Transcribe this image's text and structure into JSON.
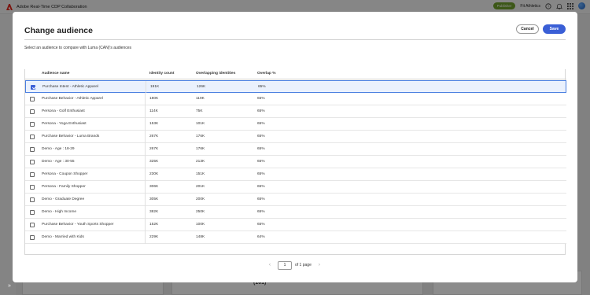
{
  "app": {
    "title": "Adobe Real-Time CDP Collaboration",
    "badge": "Publisher",
    "org": "Fit Athletics"
  },
  "background": {
    "count_label": "(101)"
  },
  "modal": {
    "title": "Change audience",
    "cancel_label": "Cancel",
    "save_label": "Save",
    "description": "Select an audience to compare with Luma (CAN)'s audiences"
  },
  "table": {
    "columns": [
      "Audience name",
      "Identity count",
      "Overlapping identities",
      "Overlap %"
    ],
    "rows": [
      {
        "name": "Purchase Intent - Athletic Apparel",
        "identity": "191K",
        "overlap": "126K",
        "pct": "65%",
        "checked": true
      },
      {
        "name": "Purchase Behavior - Athletic Apparel",
        "identity": "180K",
        "overlap": "119K",
        "pct": "65%",
        "checked": false
      },
      {
        "name": "Persona - Golf Enthusiast",
        "identity": "114K",
        "overlap": "75K",
        "pct": "65%",
        "checked": false
      },
      {
        "name": "Persona - Yoga Enthusiast",
        "identity": "153K",
        "overlap": "101K",
        "pct": "65%",
        "checked": false
      },
      {
        "name": "Purchase Behavior - Luma Brands",
        "identity": "267K",
        "overlap": "176K",
        "pct": "65%",
        "checked": false
      },
      {
        "name": "Demo - Age : 18-29",
        "identity": "267K",
        "overlap": "176K",
        "pct": "65%",
        "checked": false
      },
      {
        "name": "Demo - Age : 30-55",
        "identity": "325K",
        "overlap": "213K",
        "pct": "65%",
        "checked": false
      },
      {
        "name": "Persona - Coupon Shopper",
        "identity": "230K",
        "overlap": "151K",
        "pct": "65%",
        "checked": false
      },
      {
        "name": "Persona - Family Shopper",
        "identity": "306K",
        "overlap": "201K",
        "pct": "65%",
        "checked": false
      },
      {
        "name": "Demo - Graduate Degree",
        "identity": "305K",
        "overlap": "200K",
        "pct": "65%",
        "checked": false
      },
      {
        "name": "Demo - High Income",
        "identity": "382K",
        "overlap": "250K",
        "pct": "65%",
        "checked": false
      },
      {
        "name": "Purchase Behavior - Youth Sports Shopper",
        "identity": "152K",
        "overlap": "100K",
        "pct": "65%",
        "checked": false
      },
      {
        "name": "Demo - Married with Kids",
        "identity": "229K",
        "overlap": "148K",
        "pct": "64%",
        "checked": false
      }
    ]
  },
  "pagination": {
    "page": "1",
    "total_label": "of 1 page"
  },
  "colors": {
    "accent": "#3a5fd6",
    "publisher_badge": "#6e9f2a",
    "selected_row": "#eaf1fd"
  }
}
